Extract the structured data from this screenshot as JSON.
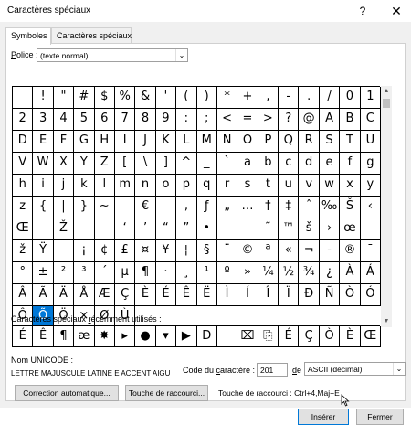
{
  "window": {
    "title": "Caractères spéciaux",
    "help_label": "?",
    "close_label": "✕"
  },
  "tabs": [
    {
      "label": "Symboles",
      "active": true
    },
    {
      "label": "Caractères spéciaux",
      "active": false
    }
  ],
  "font": {
    "label_pre": "",
    "label_u": "P",
    "label_post": "olice :",
    "value": "(texte normal)"
  },
  "symbols": [
    " ",
    "!",
    "\"",
    "#",
    "$",
    "%",
    "&",
    "'",
    "(",
    ")",
    "*",
    "+",
    ",",
    "-",
    ".",
    "/",
    "0",
    "1",
    "2",
    "3",
    "4",
    "5",
    "6",
    "7",
    "8",
    "9",
    ":",
    ";",
    "<",
    "=",
    ">",
    "?",
    "@",
    "A",
    "B",
    "C",
    "D",
    "E",
    "F",
    "G",
    "H",
    "I",
    "J",
    "K",
    "L",
    "M",
    "N",
    "O",
    "P",
    "Q",
    "R",
    "S",
    "T",
    "U",
    "V",
    "W",
    "X",
    "Y",
    "Z",
    "[",
    "\\",
    "]",
    "^",
    "_",
    "`",
    "a",
    "b",
    "c",
    "d",
    "e",
    "f",
    "g",
    "h",
    "i",
    "j",
    "k",
    "l",
    "m",
    "n",
    "o",
    "p",
    "q",
    "r",
    "s",
    "t",
    "u",
    "v",
    "w",
    "x",
    "y",
    "z",
    "{",
    "|",
    "}",
    "~",
    "",
    "€",
    "",
    "‚",
    "ƒ",
    "„",
    "…",
    "†",
    "‡",
    "ˆ",
    "‰",
    "Š",
    "‹",
    "Œ",
    "",
    "Ž",
    "",
    "",
    "‘",
    "’",
    "“",
    "”",
    "•",
    "–",
    "—",
    "˜",
    "™",
    "š",
    "›",
    "œ",
    "",
    "ž",
    "Ÿ",
    " ",
    "¡",
    "¢",
    "£",
    "¤",
    "¥",
    "¦",
    "§",
    "¨",
    "©",
    "ª",
    "«",
    "¬",
    "-",
    "®",
    "¯",
    "°",
    "±",
    "²",
    "³",
    "´",
    "µ",
    "¶",
    "·",
    "¸",
    "¹",
    "º",
    "»",
    "¼",
    "½",
    "¾",
    "¿",
    "À",
    "Á",
    "Â",
    "Ã",
    "Ä",
    "Å",
    "Æ",
    "Ç",
    "È",
    "É",
    "Ê",
    "Ë",
    "Ì",
    "Í",
    "Î",
    "Ï",
    "Ð",
    "Ñ",
    "Ò",
    "Ó",
    "Ô",
    "Õ",
    "Ö",
    "×",
    "Ø",
    "Ù"
  ],
  "selected_index": 181,
  "recent": {
    "label_pre": "Caractères spéciaux ",
    "label_u": "r",
    "label_post": "écemment utilisés :",
    "items": [
      "É",
      "Ê",
      "¶",
      "æ",
      "✸",
      "▸",
      "●",
      "▾",
      "▶",
      "D",
      "",
      "⌧",
      "⎘",
      "É",
      "Ç",
      "Ò",
      "È",
      "Œ"
    ]
  },
  "unicode": {
    "label": "Nom UNICODE :",
    "name": "LETTRE MAJUSCULE LATINE E ACCENT AIGU"
  },
  "code": {
    "label_pre": "Code du ",
    "label_u": "c",
    "label_post": "aractère :",
    "value": "201"
  },
  "from": {
    "label_u": "d",
    "label_post": "e :",
    "value": "ASCII (décimal)"
  },
  "buttons": {
    "auto_correct": "Correction automatique...",
    "shortcut_key": "Touche de raccourci...",
    "shortcut_text": "Touche de raccourci : Ctrl+4,Maj+E",
    "insert": "Insérer",
    "close": "Fermer"
  },
  "colors": {
    "selection": "#0078d7",
    "dialog_bg": "#f0f0f0"
  },
  "icons": {
    "dropdown": "chevron-down-icon",
    "cursor": "mouse-pointer-icon"
  }
}
